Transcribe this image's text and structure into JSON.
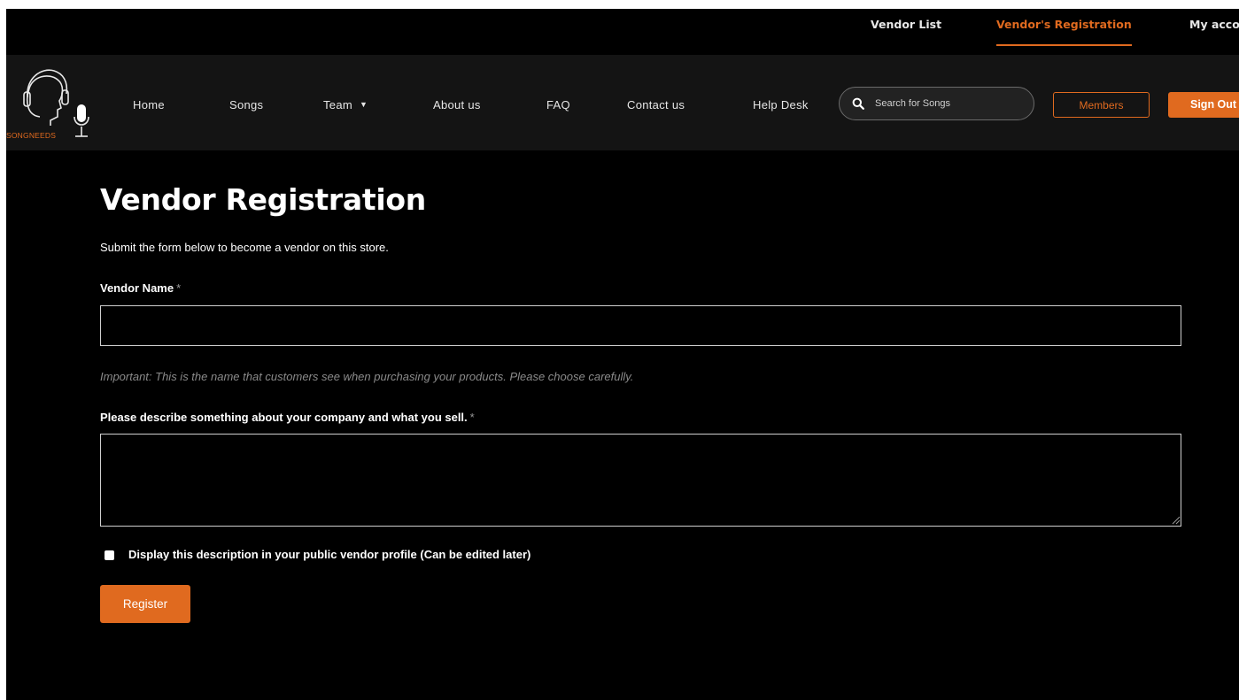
{
  "topbar": {
    "links": [
      {
        "label": "Vendor List",
        "active": false
      },
      {
        "label": "Vendor's Registration",
        "active": true
      },
      {
        "label": "My acco",
        "active": false
      }
    ]
  },
  "header": {
    "logo_text": "SONGNEEDS",
    "nav": [
      {
        "label": "Home"
      },
      {
        "label": "Songs"
      },
      {
        "label": "Team",
        "has_dropdown": true,
        "caret": "▼"
      },
      {
        "label": "About us"
      },
      {
        "label": "FAQ"
      },
      {
        "label": "Contact us"
      },
      {
        "label": "Help Desk"
      }
    ],
    "search_placeholder": "Search for Songs",
    "members_label": "Members",
    "signout_label": "Sign Out"
  },
  "form": {
    "title": "Vendor Registration",
    "subtitle": "Submit the form below to become a vendor on this store.",
    "vendor_name_label": "Vendor Name",
    "required_mark": "*",
    "vendor_name_value": "",
    "vendor_name_hint": "Important: This is the name that customers see when purchasing your products. Please choose carefully.",
    "description_label": "Please describe something about your company and what you sell.",
    "description_value": "",
    "display_checkbox_label": "Display this description in your public vendor profile (Can be edited later)",
    "display_checkbox_checked": false,
    "register_label": "Register"
  },
  "colors": {
    "accent": "#e06a1f",
    "background": "#000000",
    "header_bg": "#141414",
    "text": "#ffffff",
    "hint_text": "#8a8a8a"
  }
}
